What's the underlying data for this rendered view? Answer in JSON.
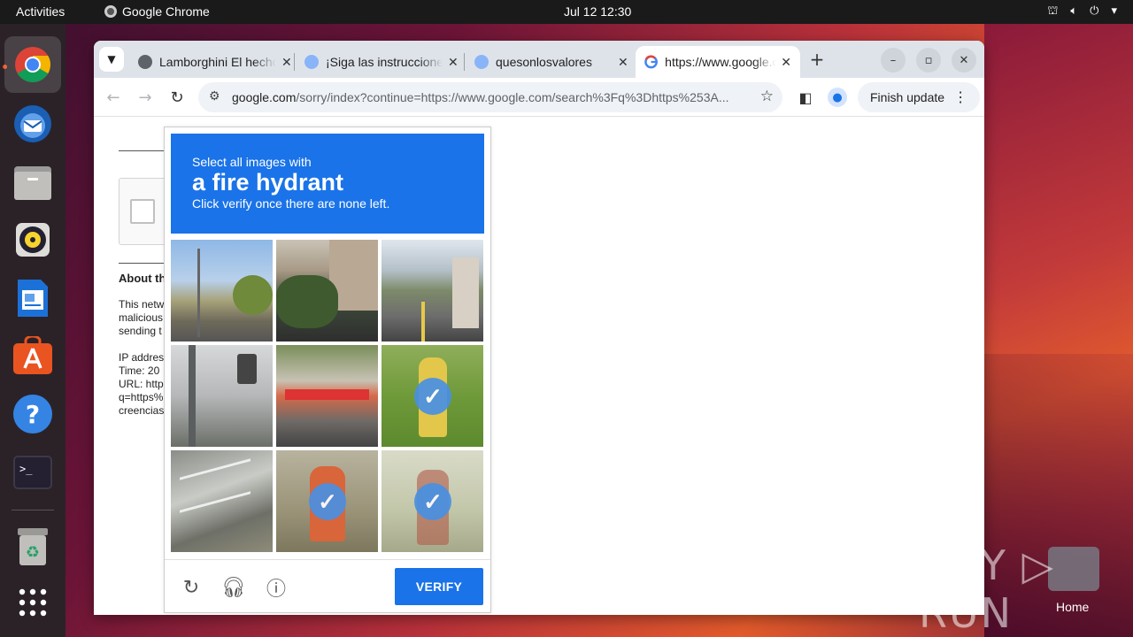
{
  "topbar": {
    "activities": "Activities",
    "app_name": "Google Chrome",
    "clock": "Jul 12  12:30"
  },
  "dock": {
    "items": [
      "chrome-icon",
      "thunderbird-icon",
      "files-icon",
      "rhythmbox-icon",
      "writer-icon",
      "app-center-icon",
      "help-icon",
      "terminal-icon",
      "trash-icon",
      "app-grid-icon"
    ]
  },
  "tabs": [
    {
      "title": "Lamborghini El hecho",
      "close": "✕"
    },
    {
      "title": "¡Siga las instrucciones",
      "close": "✕"
    },
    {
      "title": "quesonlosvalores",
      "close": "✕"
    },
    {
      "title": "https://www.google.com",
      "close": "✕"
    }
  ],
  "new_tab": "+",
  "window_controls": {
    "minimize": "–",
    "maximize": "▫",
    "close": "✕"
  },
  "omnibox": {
    "domain": "google.com",
    "path": "/sorry/index?continue=https://www.google.com/search%3Fq%3Dhttps%253A..."
  },
  "finish_update": "Finish update",
  "page": {
    "about": "About th",
    "para1": [
      "This netw",
      "malicious",
      "sending t"
    ],
    "para2": [
      "IP addres",
      "Time: 20",
      "URL: http",
      "q=https%",
      "creencias"
    ]
  },
  "captcha": {
    "line1": "Select all images with",
    "line2": "a fire hydrant",
    "line3": "Click verify once there are none left.",
    "verify": "VERIFY",
    "selected": [
      false,
      false,
      false,
      false,
      false,
      true,
      false,
      true,
      true
    ]
  },
  "watermark": "ANY ▷ RUN",
  "home_label": "Home",
  "colors": {
    "accent": "#1a73e8",
    "ubuntu_orange": "#e95420"
  }
}
